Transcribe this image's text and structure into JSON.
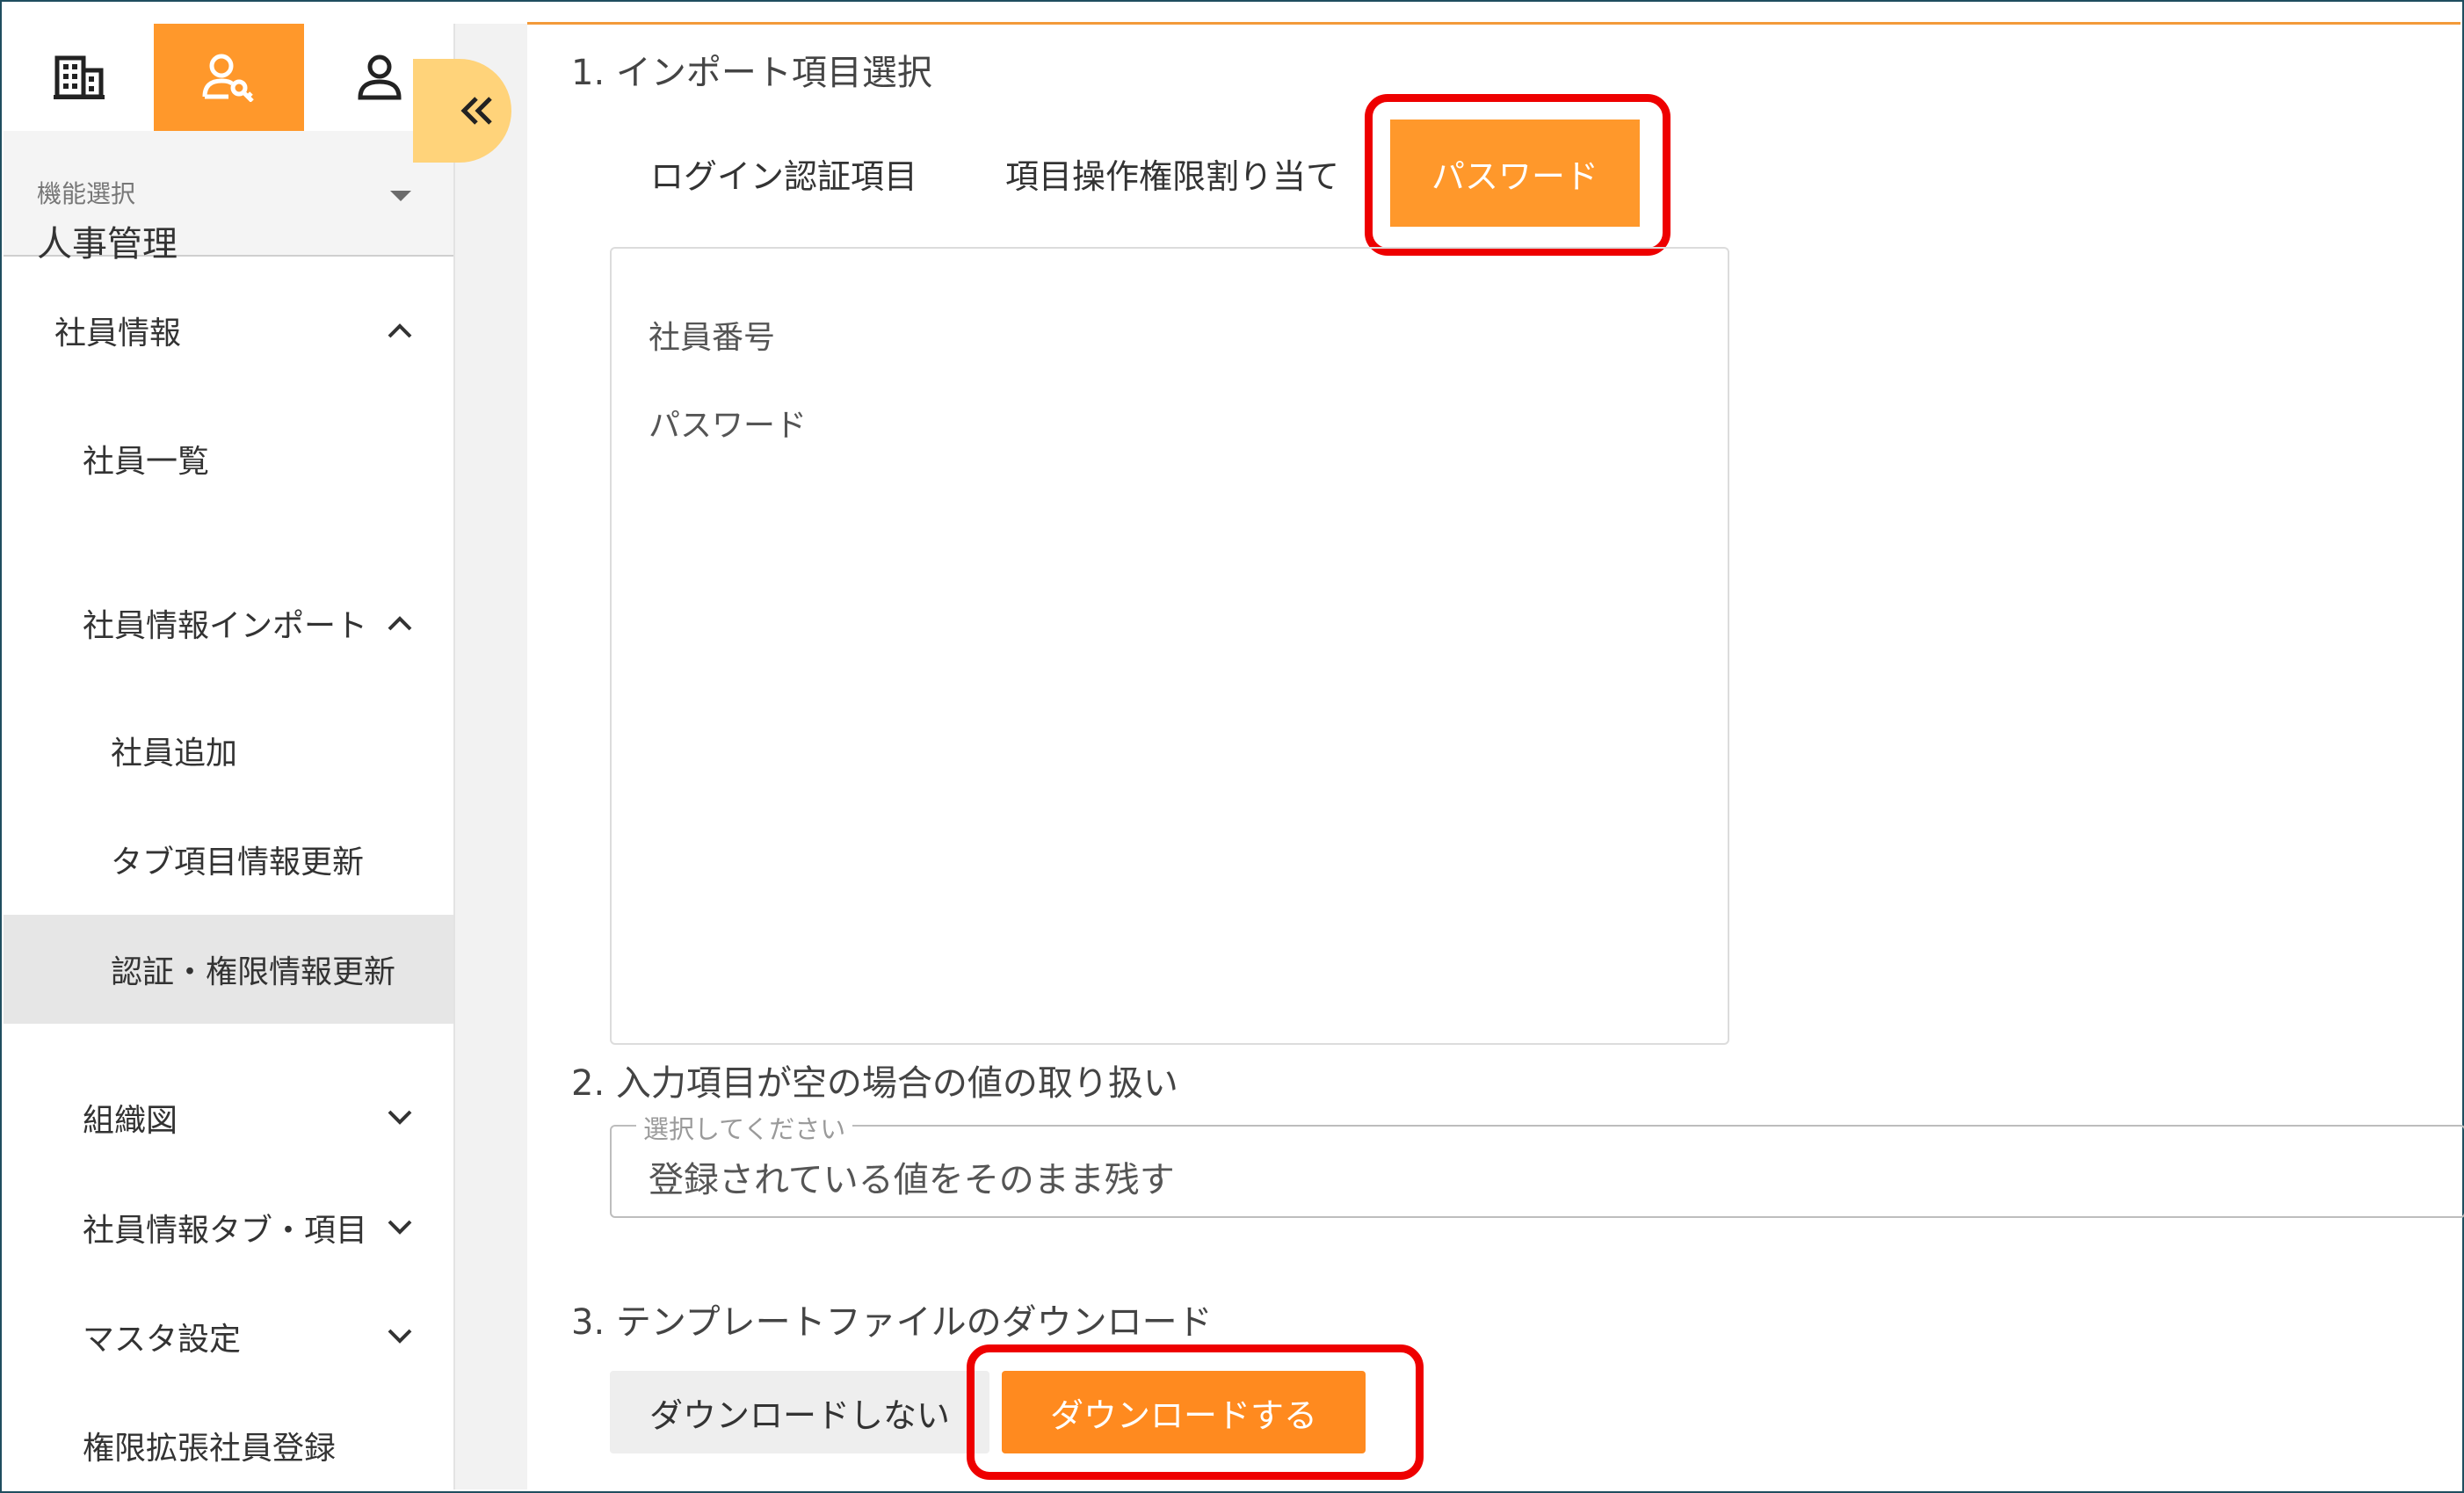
{
  "colors": {
    "accent": "#ff982b",
    "highlight": "#ee0000",
    "top_line": "#f39a3a",
    "collapse_button": "#ffd37a"
  },
  "sidebar": {
    "icon_tabs": [
      {
        "icon": "building-icon",
        "active": false
      },
      {
        "icon": "user-key-icon",
        "active": true
      },
      {
        "icon": "person-icon",
        "active": false
      }
    ],
    "function_select": {
      "label": "機能選択",
      "value": "人事管理",
      "icon": "caret-down-icon"
    },
    "items": [
      {
        "label": "社員情報",
        "chevron": "chevron-up-icon"
      },
      {
        "label": "社員一覧"
      },
      {
        "label": "社員情報インポート",
        "chevron": "chevron-up-icon"
      },
      {
        "label": "社員追加"
      },
      {
        "label": "タブ項目情報更新"
      },
      {
        "label": "認証・権限情報更新",
        "selected": true
      },
      {
        "label": "組織図",
        "chevron": "chevron-down-icon"
      },
      {
        "label": "社員情報タブ・項目",
        "chevron": "chevron-down-icon"
      },
      {
        "label": "マスタ設定",
        "chevron": "chevron-down-icon"
      },
      {
        "label": "権限拡張社員登録"
      }
    ],
    "collapse_icon": "double-chevron-left-icon"
  },
  "main": {
    "section1": {
      "title": "1. インポート項目選択",
      "tabs": [
        {
          "label": "ログイン認証項目"
        },
        {
          "label": "項目操作権限割り当て"
        },
        {
          "label": "パスワード",
          "active": true
        }
      ],
      "items": [
        "社員番号",
        "パスワード"
      ]
    },
    "section2": {
      "title": "2. 入力項目が空の場合の値の取り扱い",
      "select_legend": "選択してください",
      "select_value": "登録されている値をそのまま残す"
    },
    "section3": {
      "title": "3. テンプレートファイルのダウンロード",
      "button_no": "ダウンロードしない",
      "button_yes": "ダウンロードする"
    }
  }
}
